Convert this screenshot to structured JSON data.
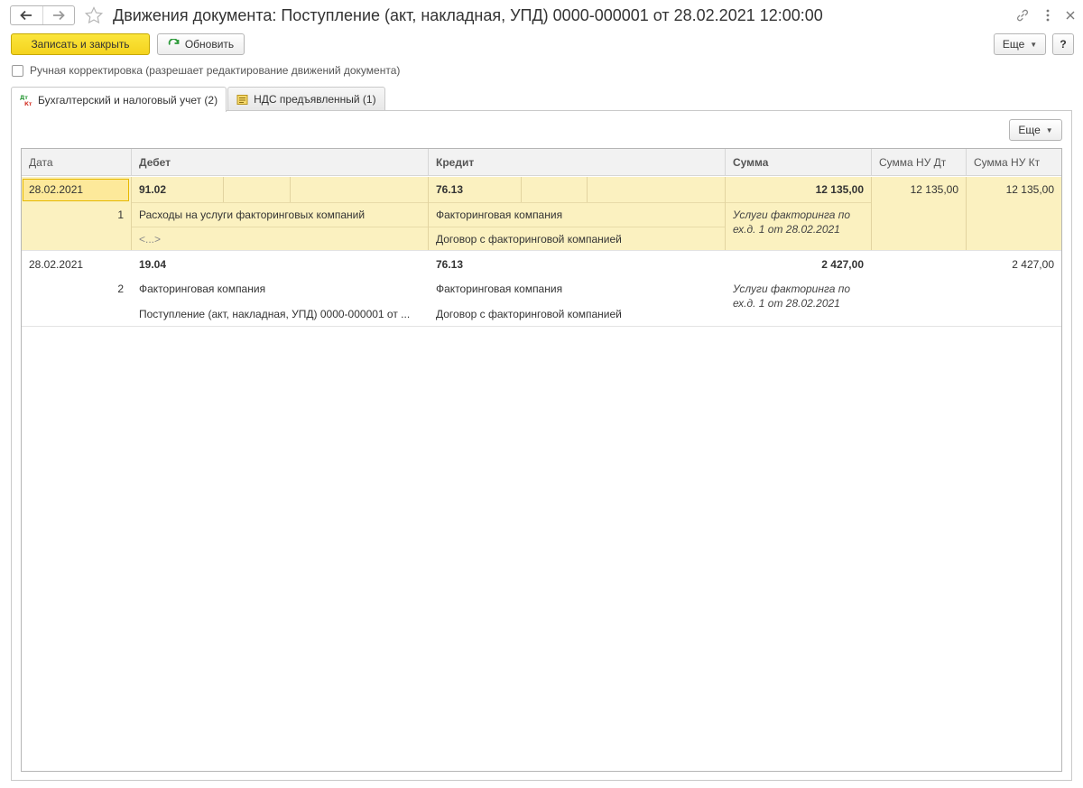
{
  "window": {
    "title": "Движения документа: Поступление (акт, накладная, УПД) 0000-000001 от 28.02.2021 12:00:00"
  },
  "toolbar": {
    "save_close_label": "Записать и закрыть",
    "refresh_label": "Обновить",
    "more_label": "Еще",
    "help_label": "?"
  },
  "manual_correction": {
    "label": "Ручная корректировка (разрешает редактирование движений документа)",
    "checked": false
  },
  "tabs": [
    {
      "label": "Бухгалтерский и налоговый учет (2)",
      "active": true,
      "icon": "dt-kt-icon"
    },
    {
      "label": "НДС предъявленный (1)",
      "active": false,
      "icon": "register-icon"
    }
  ],
  "table": {
    "more_label": "Еще",
    "columns": [
      "Дата",
      "Дебет",
      "Кредит",
      "Сумма",
      "Сумма НУ Дт",
      "Сумма НУ Кт"
    ],
    "rows": [
      {
        "date": "28.02.2021",
        "number": "1",
        "debit_account": "91.02",
        "debit_sub1": "Расходы на услуги факторинговых компаний",
        "debit_sub2": "<...>",
        "credit_account": "76.13",
        "credit_sub1": "Факторинговая компания",
        "credit_sub2": "Договор с факторинговой компанией",
        "amount": "12 135,00",
        "content": "Услуги факторинга по ех.д. 1 от 28.02.2021",
        "amount_nu_dt": "12 135,00",
        "amount_nu_kt": "12 135,00"
      },
      {
        "date": "28.02.2021",
        "number": "2",
        "debit_account": "19.04",
        "debit_sub1": "Факторинговая компания",
        "debit_sub2": "Поступление (акт, накладная, УПД) 0000-000001 от ...",
        "credit_account": "76.13",
        "credit_sub1": "Факторинговая компания",
        "credit_sub2": "Договор с факторинговой компанией",
        "amount": "2 427,00",
        "content": "Услуги факторинга по ех.д. 1 от 28.02.2021",
        "amount_nu_dt": "",
        "amount_nu_kt": "2 427,00"
      }
    ]
  },
  "colors": {
    "primary_button": "#f4d31e",
    "selected_row": "#fbf1c0",
    "current_cell": "#fde99a"
  }
}
